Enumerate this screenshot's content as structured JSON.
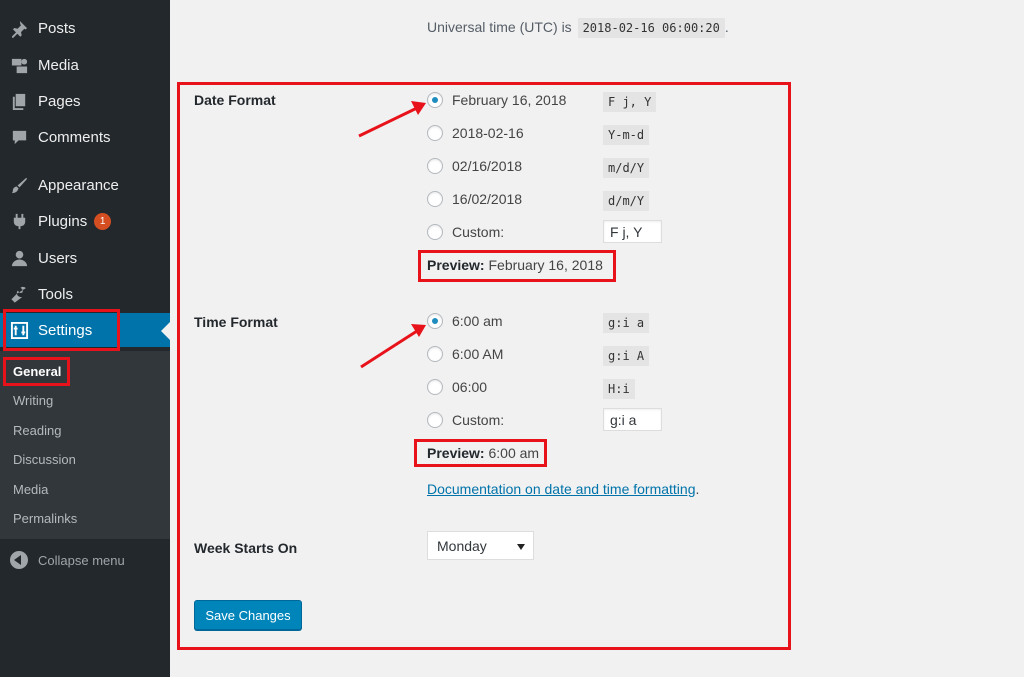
{
  "sidebar": {
    "items": [
      {
        "label": "Posts",
        "icon": "pushpin-icon"
      },
      {
        "label": "Media",
        "icon": "media-icon"
      },
      {
        "label": "Pages",
        "icon": "pages-icon"
      },
      {
        "label": "Comments",
        "icon": "comment-icon"
      },
      {
        "label": "Appearance",
        "icon": "paintbrush-icon"
      },
      {
        "label": "Plugins",
        "icon": "plugin-icon",
        "badge": "1"
      },
      {
        "label": "Users",
        "icon": "user-icon"
      },
      {
        "label": "Tools",
        "icon": "wrench-icon"
      },
      {
        "label": "Settings",
        "icon": "settings-icon"
      }
    ],
    "submenu": [
      "General",
      "Writing",
      "Reading",
      "Discussion",
      "Media",
      "Permalinks"
    ],
    "collapse_label": "Collapse menu"
  },
  "utc": {
    "label": "Universal time (UTC) is",
    "value": "2018-02-16 06:00:20",
    "suffix": "."
  },
  "date_format": {
    "label": "Date Format",
    "options": [
      {
        "label": "February 16, 2018",
        "code": "F j, Y",
        "checked": true
      },
      {
        "label": "2018-02-16",
        "code": "Y-m-d",
        "checked": false
      },
      {
        "label": "02/16/2018",
        "code": "m/d/Y",
        "checked": false
      },
      {
        "label": "16/02/2018",
        "code": "d/m/Y",
        "checked": false
      }
    ],
    "custom_label": "Custom:",
    "custom_value": "F j, Y",
    "preview_label": "Preview:",
    "preview_value": "February 16, 2018"
  },
  "time_format": {
    "label": "Time Format",
    "options": [
      {
        "label": "6:00 am",
        "code": "g:i a",
        "checked": true
      },
      {
        "label": "6:00 AM",
        "code": "g:i A",
        "checked": false
      },
      {
        "label": "06:00",
        "code": "H:i",
        "checked": false
      }
    ],
    "custom_label": "Custom:",
    "custom_value": "g:i a",
    "preview_label": "Preview:",
    "preview_value": "6:00 am"
  },
  "doc_link": {
    "text": "Documentation on date and time formatting",
    "suffix": "."
  },
  "week_starts": {
    "label": "Week Starts On",
    "selected": "Monday"
  },
  "save_label": "Save Changes",
  "colors": {
    "sidebar_bg": "#23282d",
    "accent": "#0073aa",
    "annotation": "#e8131a",
    "button": "#0085ba"
  }
}
